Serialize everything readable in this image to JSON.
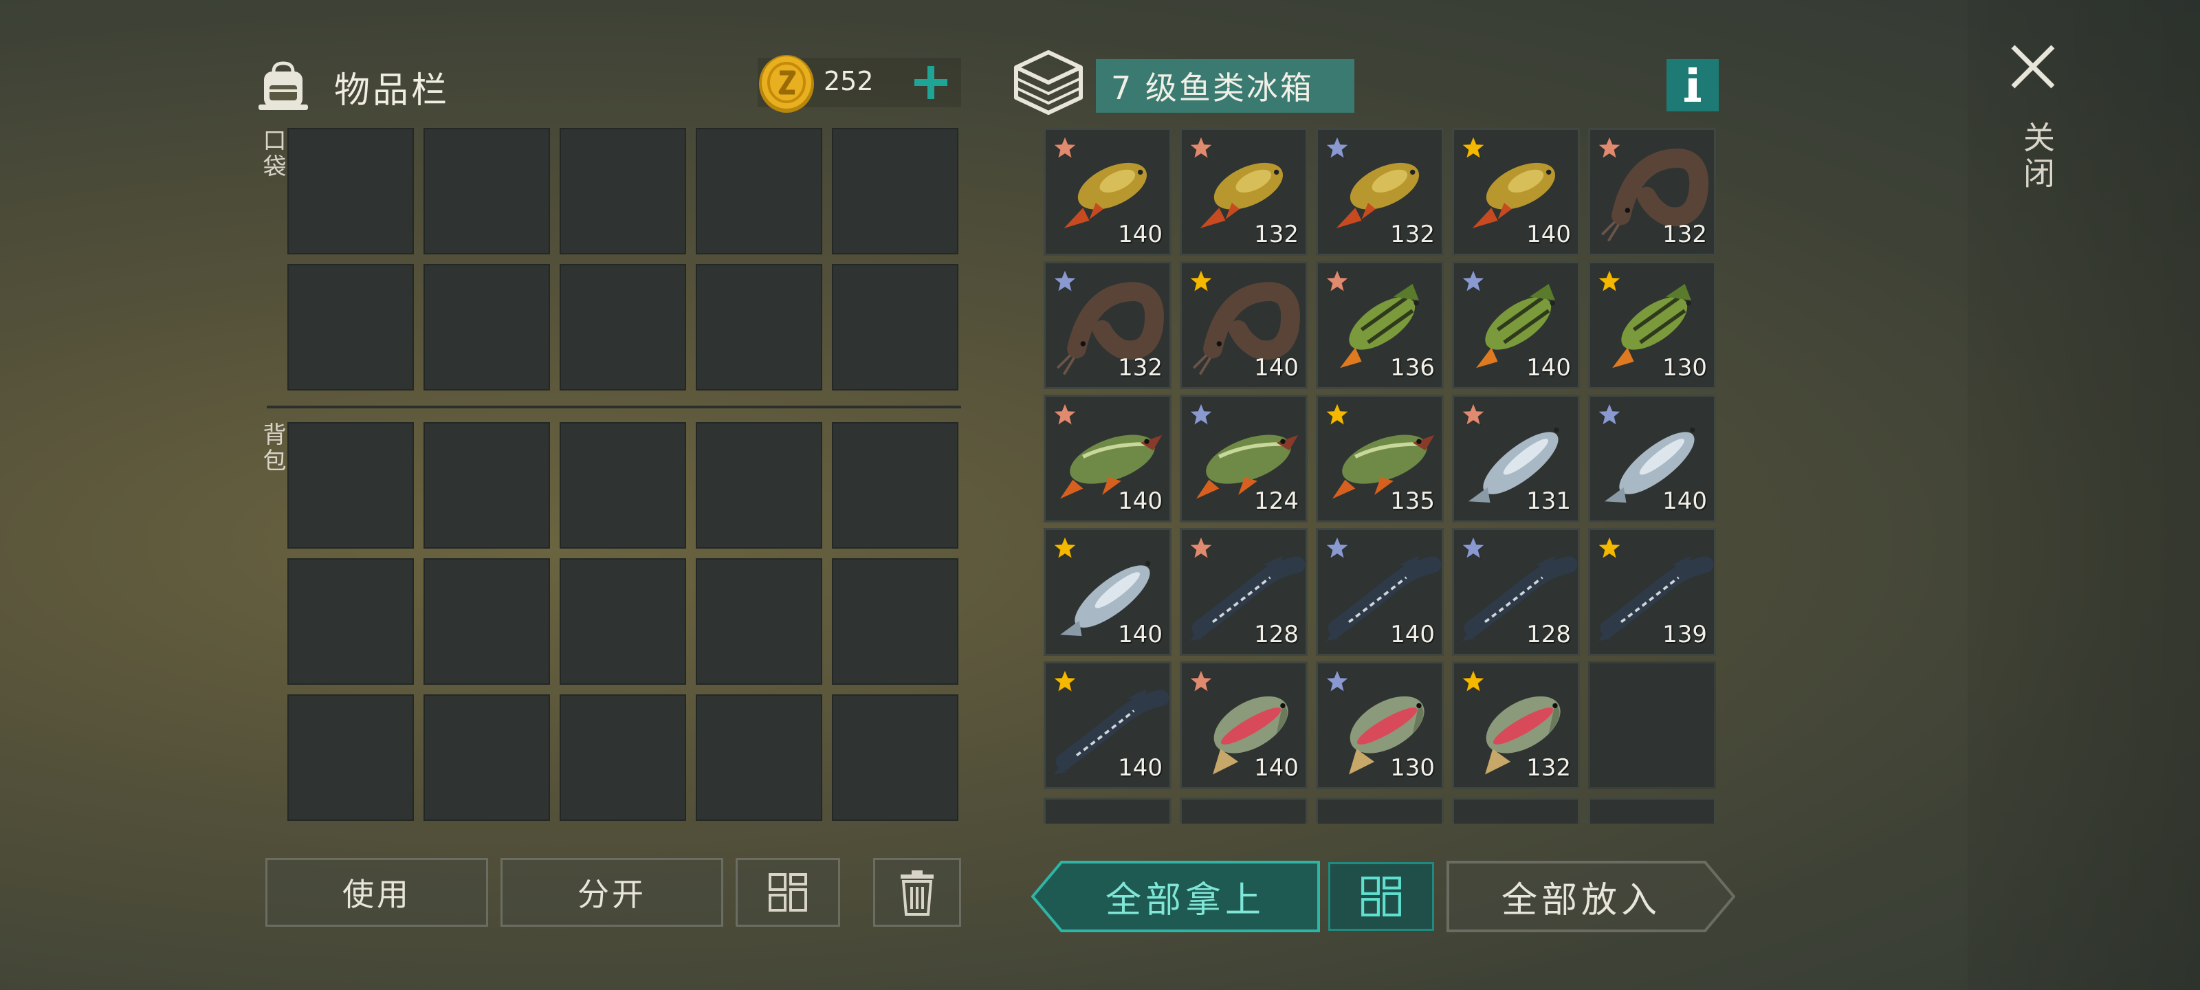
{
  "inventory": {
    "title": "物品栏",
    "coins": "252",
    "pocket_label": "口袋",
    "backpack_label": "背包",
    "pocket_slots": 10,
    "backpack_slots": 15
  },
  "buttons": {
    "use": "使用",
    "split": "分开",
    "take_all": "全部拿上",
    "put_all": "全部放入"
  },
  "fish_box": {
    "title": "7 级鱼类冰箱",
    "items": [
      {
        "fish": "carp",
        "star": "bronze",
        "value": "140"
      },
      {
        "fish": "carp",
        "star": "bronze",
        "value": "132"
      },
      {
        "fish": "carp",
        "star": "silver",
        "value": "132"
      },
      {
        "fish": "carp",
        "star": "gold",
        "value": "140"
      },
      {
        "fish": "catfish",
        "star": "bronze",
        "value": "132"
      },
      {
        "fish": "catfish",
        "star": "silver",
        "value": "132"
      },
      {
        "fish": "catfish",
        "star": "gold",
        "value": "140"
      },
      {
        "fish": "perch",
        "star": "bronze",
        "value": "136"
      },
      {
        "fish": "perch",
        "star": "silver",
        "value": "140"
      },
      {
        "fish": "perch",
        "star": "gold",
        "value": "130"
      },
      {
        "fish": "pike",
        "star": "bronze",
        "value": "140"
      },
      {
        "fish": "pike",
        "star": "silver",
        "value": "124"
      },
      {
        "fish": "pike",
        "star": "gold",
        "value": "135"
      },
      {
        "fish": "salmon",
        "star": "bronze",
        "value": "131"
      },
      {
        "fish": "salmon",
        "star": "silver",
        "value": "140"
      },
      {
        "fish": "salmon",
        "star": "gold",
        "value": "140"
      },
      {
        "fish": "sturgeon",
        "star": "bronze",
        "value": "128"
      },
      {
        "fish": "sturgeon",
        "star": "silver",
        "value": "140"
      },
      {
        "fish": "sturgeon",
        "star": "silver",
        "value": "128"
      },
      {
        "fish": "sturgeon",
        "star": "gold",
        "value": "139"
      },
      {
        "fish": "sturgeon",
        "star": "gold",
        "value": "140"
      },
      {
        "fish": "trout",
        "star": "bronze",
        "value": "140"
      },
      {
        "fish": "trout",
        "star": "silver",
        "value": "130"
      },
      {
        "fish": "trout",
        "star": "gold",
        "value": "132"
      },
      {
        "fish": "",
        "star": "",
        "value": ""
      }
    ]
  },
  "close_label": "关闭",
  "colors": {
    "accent_teal": "#1e7a74",
    "title_bg": "#3a7a70",
    "star_gold": "#f5b800",
    "star_silver": "#8a9ad0",
    "star_bronze": "#e08a70"
  }
}
